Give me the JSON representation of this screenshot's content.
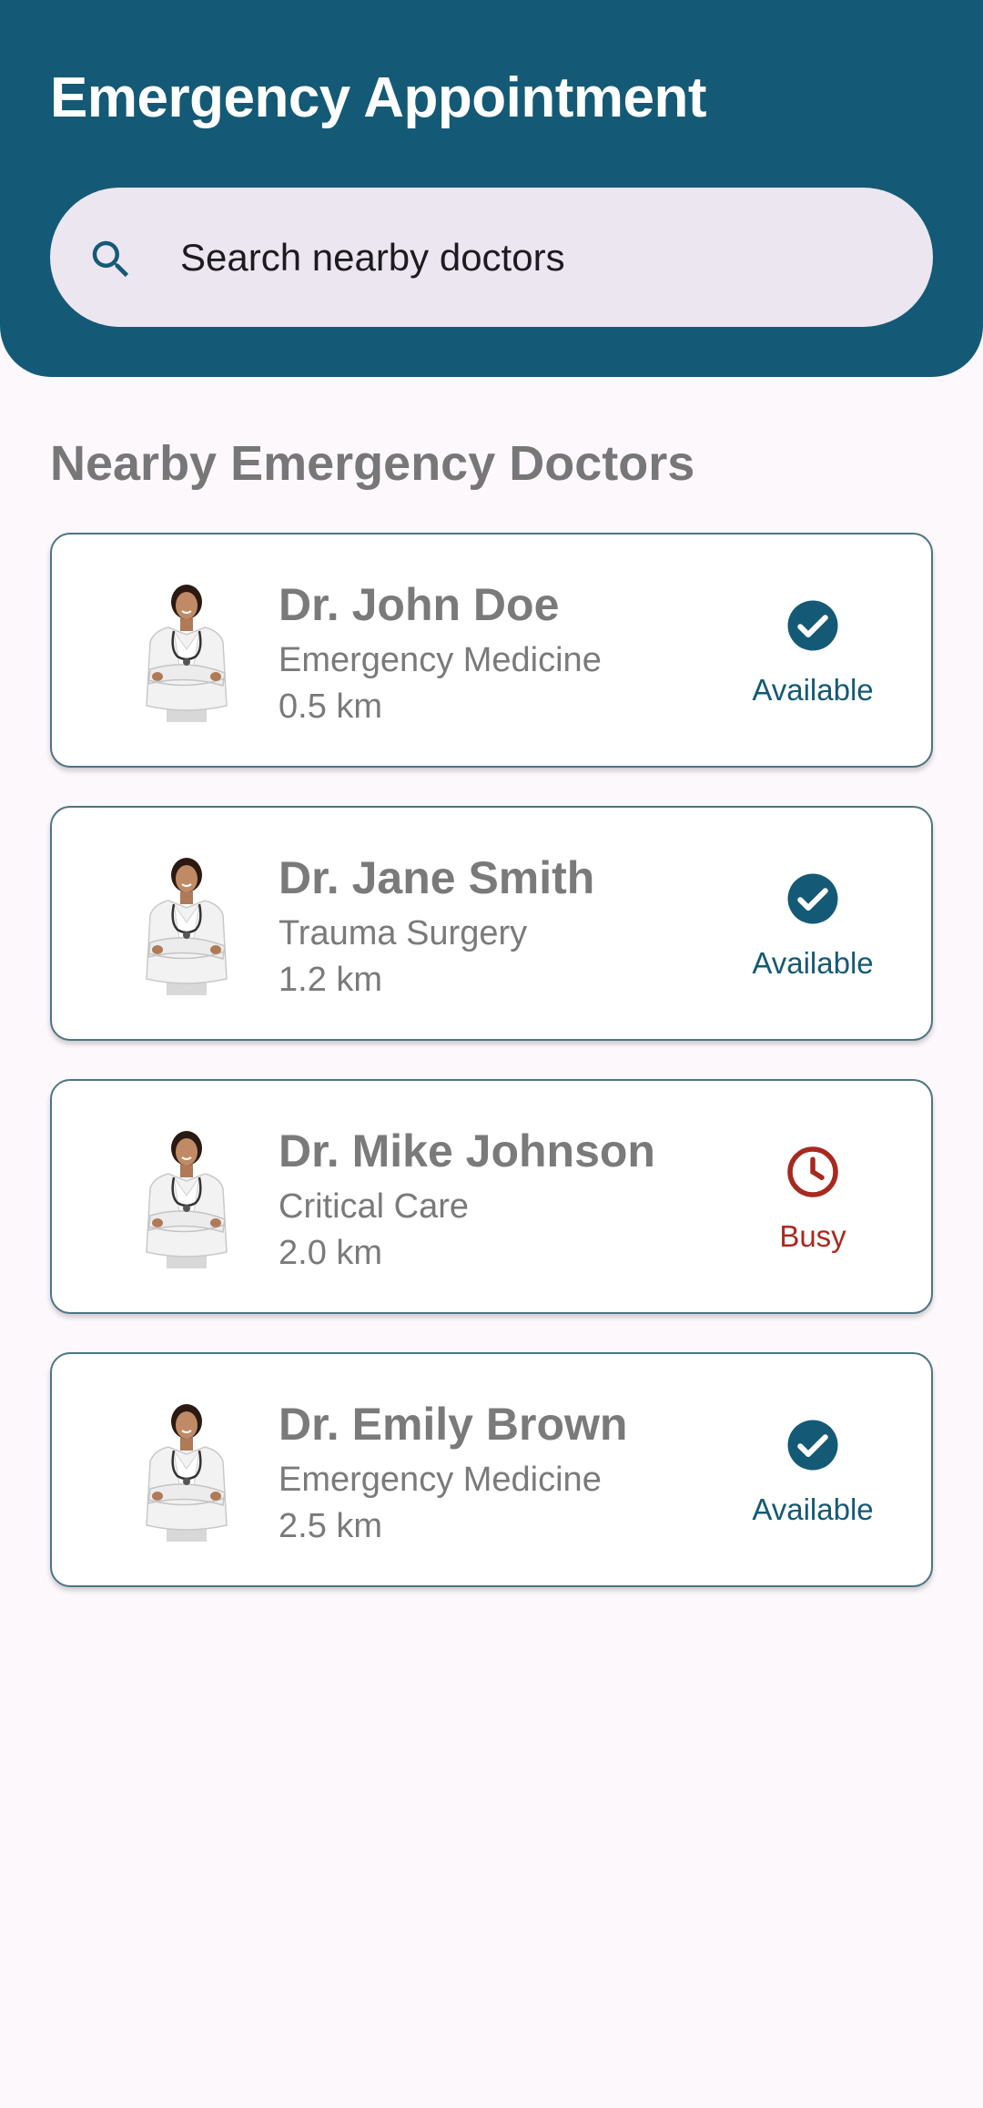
{
  "colors": {
    "primary": "#145a76",
    "available": "#145a76",
    "busy": "#a8291f",
    "search_bg": "#ece6f1",
    "page_bg": "#fdf8fc"
  },
  "header": {
    "title": "Emergency Appointment"
  },
  "search": {
    "icon": "search-icon",
    "placeholder": "Search nearby doctors",
    "value": ""
  },
  "section": {
    "title": "Nearby Emergency Doctors"
  },
  "doctors": [
    {
      "avatar_icon": "doctor-avatar",
      "name": "Dr. John Doe",
      "specialty": "Emergency Medicine",
      "distance": "0.5 km",
      "status": "Available",
      "status_icon": "check-circle-icon"
    },
    {
      "avatar_icon": "doctor-avatar",
      "name": "Dr. Jane Smith",
      "specialty": "Trauma Surgery",
      "distance": "1.2 km",
      "status": "Available",
      "status_icon": "check-circle-icon"
    },
    {
      "avatar_icon": "doctor-avatar",
      "name": "Dr. Mike Johnson",
      "specialty": "Critical Care",
      "distance": "2.0 km",
      "status": "Busy",
      "status_icon": "clock-icon"
    },
    {
      "avatar_icon": "doctor-avatar",
      "name": "Dr. Emily Brown",
      "specialty": "Emergency Medicine",
      "distance": "2.5 km",
      "status": "Available",
      "status_icon": "check-circle-icon"
    }
  ]
}
